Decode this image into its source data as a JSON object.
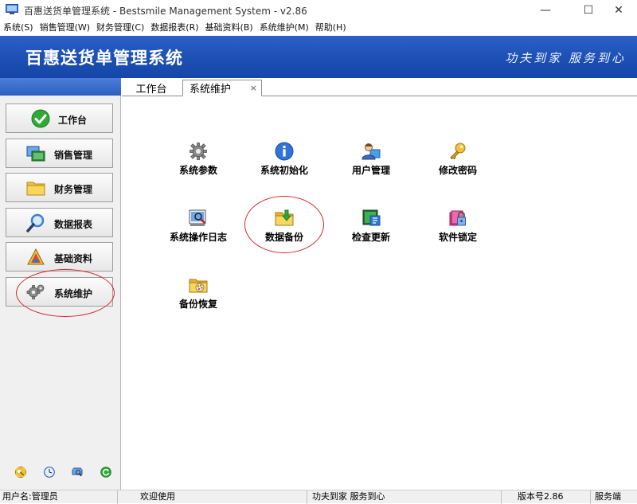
{
  "window": {
    "title": "百惠送货单管理系统 - Bestsmile Management System - v2.86",
    "minimize": "—",
    "maximize": "☐",
    "close": "✕"
  },
  "menubar": [
    "系统(S)",
    "销售管理(W)",
    "财务管理(C)",
    "数据报表(R)",
    "基础资料(B)",
    "系统维护(M)",
    "帮助(H)"
  ],
  "banner": {
    "title": "百惠送货单管理系统",
    "slogan": "功夫到家 服务到心"
  },
  "sidebar": {
    "items": [
      {
        "label": "工作台",
        "icon": "checkmark-icon",
        "color": "#2fa936"
      },
      {
        "label": "销售管理",
        "icon": "windows-icon",
        "color": "#2f6fce"
      },
      {
        "label": "财务管理",
        "icon": "folder-icon",
        "color": "#f2c232"
      },
      {
        "label": "数据报表",
        "icon": "magnifier-icon",
        "color": "#3b7fd6"
      },
      {
        "label": "基础资料",
        "icon": "color-palette-icon",
        "color": "#d24a3a"
      },
      {
        "label": "系统维护",
        "icon": "gear-icon",
        "color": "#7b7b7b"
      }
    ],
    "bottom_icons": [
      "key-icon",
      "clock-icon",
      "monitor-icon",
      "refresh-icon"
    ]
  },
  "tabs": [
    {
      "label": "工作台",
      "active": false
    },
    {
      "label": "系统维护",
      "active": true,
      "close": "×"
    }
  ],
  "tiles": [
    {
      "label": "系统参数",
      "icon": "gear-icon"
    },
    {
      "label": "系统初始化",
      "icon": "info-icon"
    },
    {
      "label": "用户管理",
      "icon": "user-icon"
    },
    {
      "label": "修改密码",
      "icon": "key-icon"
    },
    {
      "label": "系统操作日志",
      "icon": "log-viewer-icon"
    },
    {
      "label": "数据备份",
      "icon": "backup-folder-icon"
    },
    {
      "label": "检查更新",
      "icon": "update-check-icon"
    },
    {
      "label": "软件锁定",
      "icon": "lock-icon"
    },
    {
      "label": "备份恢复",
      "icon": "restore-folder-icon"
    }
  ],
  "statusbar": {
    "user": "用户名:管理员",
    "welcome": "欢迎使用",
    "slogan": "功夫到家 服务到心",
    "version": "版本号2.86",
    "mode": "服务端"
  },
  "colors": {
    "banner": "#1d4fb4",
    "highlight_circle": "#d7262c"
  }
}
